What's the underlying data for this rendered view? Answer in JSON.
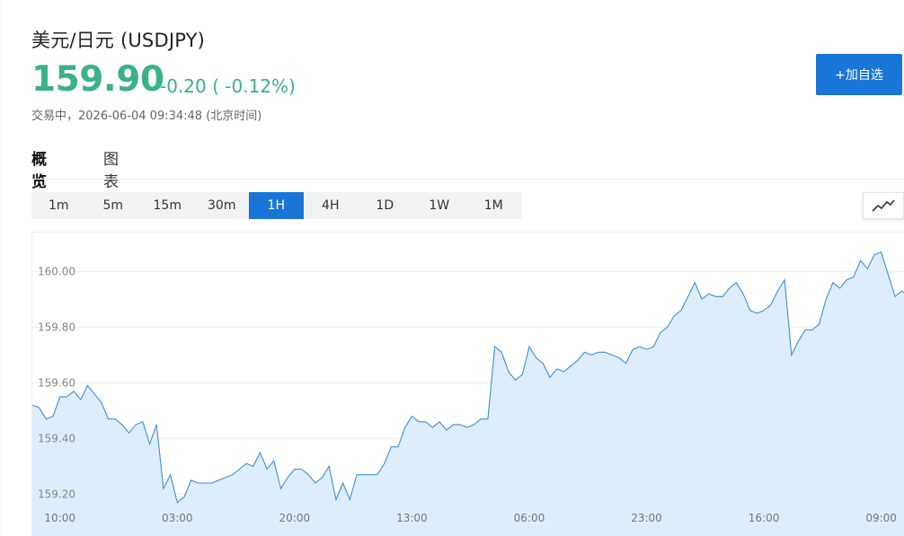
{
  "header": {
    "title": "美元/日元 (USDJPY)",
    "price": "159.90",
    "change": "-0.20 ( -0.12%)",
    "status": "交易中，2026-06-04 09:34:48 (北京时间)",
    "add_button": "+加自选"
  },
  "tabs": [
    {
      "label": "概览",
      "active": true
    },
    {
      "label": "图表",
      "active": false
    }
  ],
  "periods": [
    {
      "label": "1m",
      "active": false
    },
    {
      "label": "5m",
      "active": false
    },
    {
      "label": "15m",
      "active": false
    },
    {
      "label": "30m",
      "active": false
    },
    {
      "label": "1H",
      "active": true
    },
    {
      "label": "4H",
      "active": false
    },
    {
      "label": "1D",
      "active": false
    },
    {
      "label": "1W",
      "active": false
    },
    {
      "label": "1M",
      "active": false
    }
  ],
  "chart_type_icon": "line-chart-icon",
  "colors": {
    "accent": "#1a75d8",
    "up_down_text": "#3bb18a",
    "line": "#3d8fd6",
    "area_fill": "#deedfb"
  },
  "chart_data": {
    "type": "area",
    "title": "",
    "xlabel": "",
    "ylabel": "",
    "ylim": [
      159.14,
      160.14
    ],
    "yticks": [
      "160.00",
      "159.80",
      "159.60",
      "159.40",
      "159.20"
    ],
    "ytick_values": [
      160.0,
      159.8,
      159.6,
      159.4,
      159.2
    ],
    "xticks": [
      "10:00",
      "03:00",
      "20:00",
      "13:00",
      "06:00",
      "23:00",
      "16:00",
      "09:00"
    ],
    "xtick_index": [
      4,
      21,
      38,
      55,
      72,
      89,
      106,
      123
    ],
    "grid": true,
    "series": [
      {
        "values": [
          159.52,
          159.51,
          159.47,
          159.48,
          159.55,
          159.55,
          159.57,
          159.54,
          159.59,
          159.56,
          159.53,
          159.47,
          159.47,
          159.45,
          159.42,
          159.45,
          159.46,
          159.38,
          159.45,
          159.22,
          159.27,
          159.17,
          159.19,
          159.25,
          159.24,
          159.24,
          159.24,
          159.25,
          159.26,
          159.27,
          159.29,
          159.31,
          159.3,
          159.35,
          159.29,
          159.32,
          159.22,
          159.26,
          159.29,
          159.29,
          159.27,
          159.24,
          159.26,
          159.3,
          159.18,
          159.24,
          159.18,
          159.27,
          159.27,
          159.27,
          159.27,
          159.31,
          159.37,
          159.37,
          159.44,
          159.48,
          159.46,
          159.46,
          159.44,
          159.46,
          159.43,
          159.45,
          159.45,
          159.44,
          159.45,
          159.47,
          159.47,
          159.73,
          159.71,
          159.64,
          159.61,
          159.63,
          159.73,
          159.69,
          159.67,
          159.62,
          159.65,
          159.64,
          159.66,
          159.68,
          159.71,
          159.7,
          159.71,
          159.71,
          159.7,
          159.69,
          159.67,
          159.72,
          159.73,
          159.72,
          159.73,
          159.78,
          159.8,
          159.84,
          159.86,
          159.91,
          159.96,
          159.9,
          159.92,
          159.91,
          159.91,
          159.94,
          159.96,
          159.92,
          159.86,
          159.85,
          159.86,
          159.88,
          159.93,
          159.97,
          159.7,
          159.75,
          159.79,
          159.79,
          159.81,
          159.9,
          159.96,
          159.94,
          159.97,
          159.98,
          160.04,
          160.01,
          160.06,
          160.07,
          159.99,
          159.91,
          159.93,
          159.91,
          159.88
        ]
      }
    ]
  }
}
